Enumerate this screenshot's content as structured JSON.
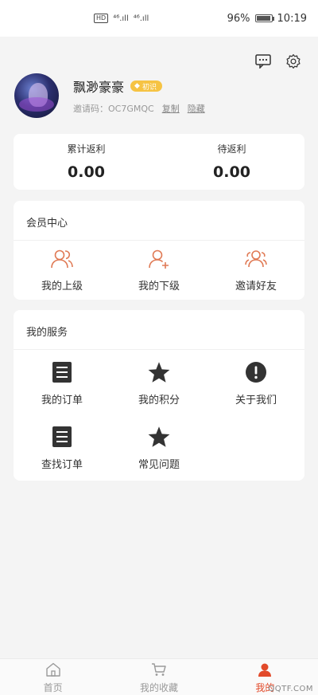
{
  "status_bar": {
    "network_label": "HD",
    "signal1": "⁴⁶.ıll",
    "signal2": "⁴⁶.ıll",
    "battery_percent_text": "96%",
    "battery_level": 0.96,
    "time": "10:19"
  },
  "actions": {
    "message_icon": "message-icon",
    "settings_icon": "gear-icon"
  },
  "profile": {
    "username": "飘渺豪豪",
    "badge_label": "初识",
    "invite_label": "邀请码：",
    "invite_code": "OC7GMQC",
    "copy_label": "复制",
    "hide_label": "隐藏"
  },
  "stats": {
    "total_label": "累计返利",
    "total_value": "0.00",
    "pending_label": "待返利",
    "pending_value": "0.00"
  },
  "member_center": {
    "title": "会员中心",
    "items": [
      {
        "label": "我的上级",
        "icon": "users-icon"
      },
      {
        "label": "我的下级",
        "icon": "user-plus-icon"
      },
      {
        "label": "邀请好友",
        "icon": "invite-friends-icon"
      }
    ]
  },
  "services": {
    "title": "我的服务",
    "items": [
      {
        "label": "我的订单",
        "icon": "order-icon"
      },
      {
        "label": "我的积分",
        "icon": "star-icon"
      },
      {
        "label": "关于我们",
        "icon": "info-icon"
      },
      {
        "label": "查找订单",
        "icon": "order-search-icon"
      },
      {
        "label": "常见问题",
        "icon": "star-icon"
      }
    ]
  },
  "bottom_nav": {
    "items": [
      {
        "label": "首页",
        "icon": "home-icon"
      },
      {
        "label": "我的收藏",
        "icon": "cart-icon"
      },
      {
        "label": "我的",
        "icon": "profile-icon"
      }
    ],
    "active_index": 2
  },
  "colors": {
    "accent": "#e24a2a",
    "icon_orange": "#e07a55",
    "badge": "#f6c343"
  },
  "watermark": "QQTF.COM"
}
